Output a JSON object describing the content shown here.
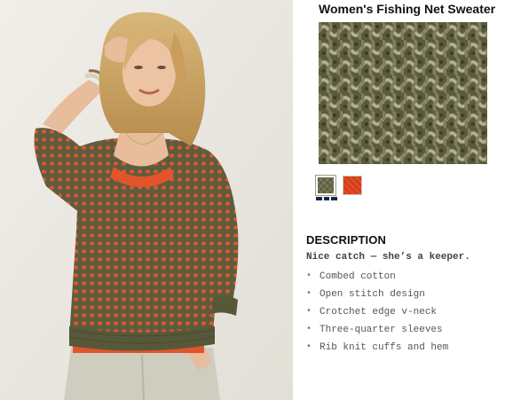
{
  "product": {
    "title": "Women's Fishing Net Sweater",
    "image_alt": "Model wearing an olive open-stitch sweater over an orange top",
    "swatch_large_alt": "Close-up of olive fishing net knit texture"
  },
  "colors": {
    "accent_navy": "#1b2547",
    "olive": "#6c6c4c",
    "orange": "#e64a22"
  },
  "swatches": [
    {
      "name": "olive",
      "selected": true
    },
    {
      "name": "orange",
      "selected": false
    }
  ],
  "description": {
    "heading": "DESCRIPTION",
    "tagline": "Nice catch — she’s a keeper.",
    "bullet_icon": "•",
    "features": [
      "Combed cotton",
      "Open stitch design",
      "Crotchet edge v-neck",
      "Three-quarter sleeves",
      "Rib knit cuffs and hem"
    ]
  }
}
